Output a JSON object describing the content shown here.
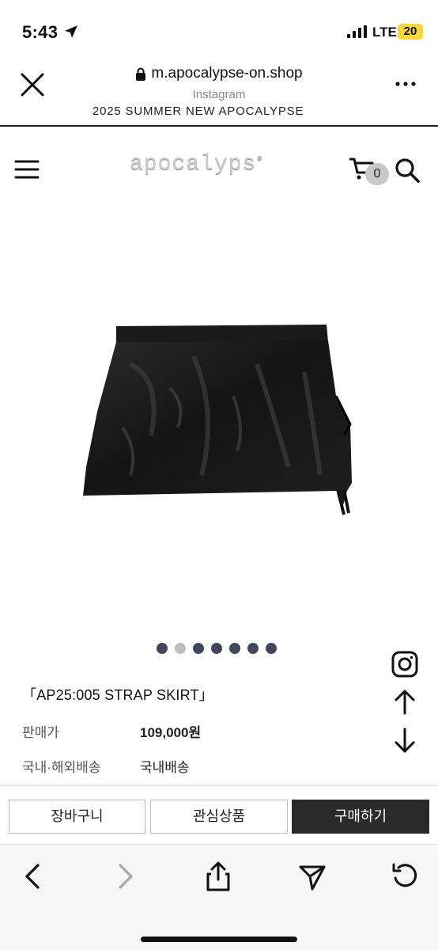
{
  "status": {
    "time": "5:43",
    "network": "LTE",
    "battery": "20"
  },
  "browser": {
    "url": "m.apocalypse-on.shop",
    "source": "Instagram"
  },
  "marquee": {
    "text": "2025 SUMMER NEW APOCALYPSE"
  },
  "site": {
    "logo": "apocalyps",
    "cart_count": "0"
  },
  "gallery": {
    "total": 7,
    "active_index": 1
  },
  "product": {
    "name": "「AP25:005 STRAP SKIRT」",
    "price_label": "판매가",
    "price_value": "109,000원",
    "shipping_label": "국내·해외배송",
    "shipping_value": "국내배송"
  },
  "actions": {
    "cart": "장바구니",
    "wishlist": "관심상품",
    "buy": "구매하기"
  },
  "colors": {
    "buy_button": "#2a2a2a",
    "dot": "#42465a",
    "dot_active": "#bdbdbd",
    "battery": "#f5d63d"
  }
}
